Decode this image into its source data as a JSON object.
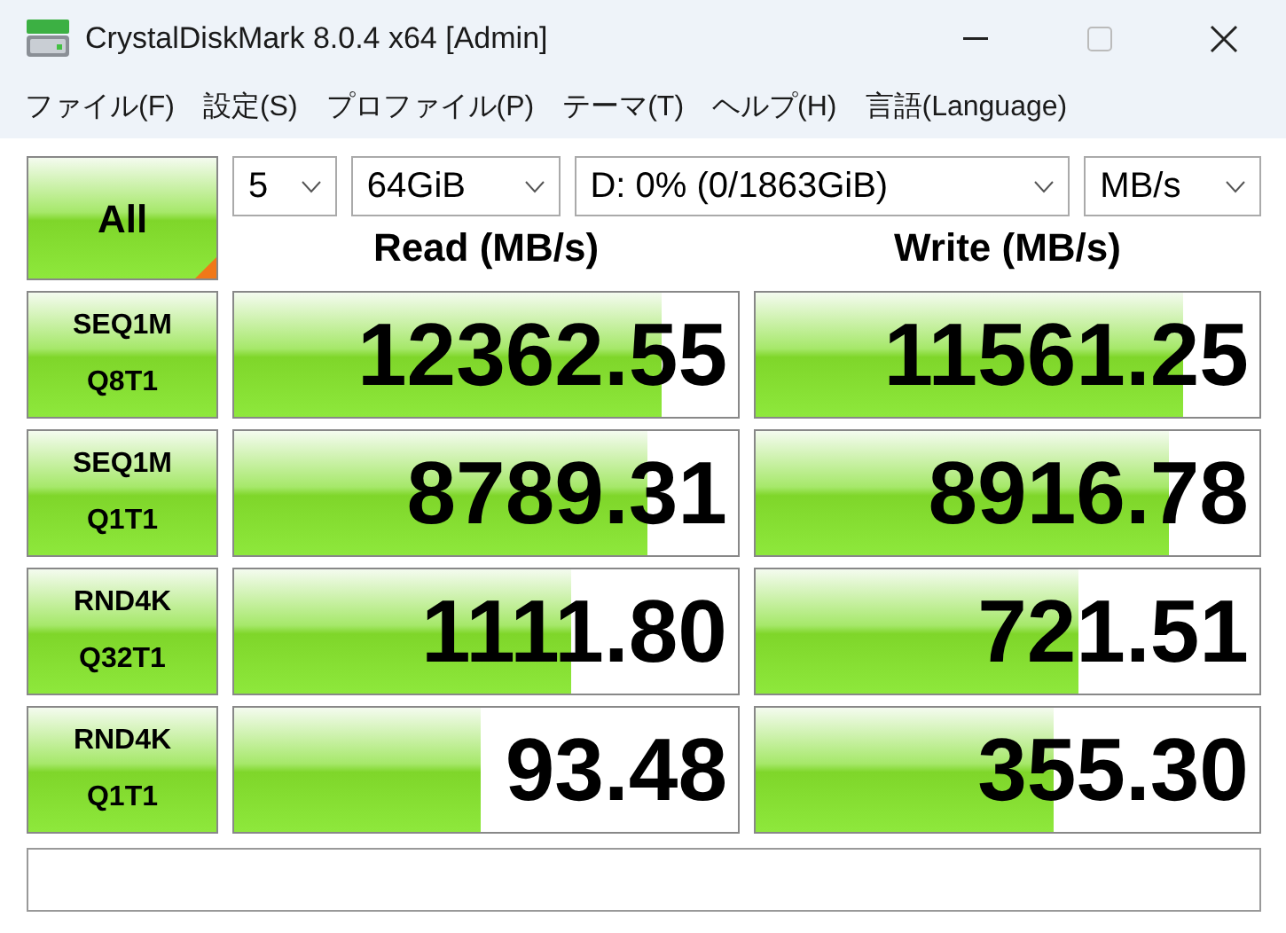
{
  "window": {
    "title": "CrystalDiskMark 8.0.4 x64 [Admin]"
  },
  "menu": [
    "ファイル(F)",
    "設定(S)",
    "プロファイル(P)",
    "テーマ(T)",
    "ヘルプ(H)",
    "言語(Language)"
  ],
  "all_button": {
    "label": "All"
  },
  "selects": [
    {
      "value": "5"
    },
    {
      "value": "64GiB"
    },
    {
      "value": "D: 0% (0/1863GiB)"
    },
    {
      "value": "MB/s"
    }
  ],
  "headers": {
    "read": "Read (MB/s)",
    "write": "Write (MB/s)"
  },
  "rows": [
    {
      "test": "SEQ1M",
      "params": "Q8T1",
      "read": {
        "value": "12362.55",
        "level": 0.85
      },
      "write": {
        "value": "11561.25",
        "level": 0.85
      }
    },
    {
      "test": "SEQ1M",
      "params": "Q1T1",
      "read": {
        "value": "8789.31",
        "level": 0.82
      },
      "write": {
        "value": "8916.78",
        "level": 0.82
      }
    },
    {
      "test": "RND4K",
      "params": "Q32T1",
      "read": {
        "value": "1111.80",
        "level": 0.67
      },
      "write": {
        "value": "721.51",
        "level": 0.64
      }
    },
    {
      "test": "RND4K",
      "params": "Q1T1",
      "read": {
        "value": "93.48",
        "level": 0.49
      },
      "write": {
        "value": "355.30",
        "level": 0.59
      }
    }
  ]
}
